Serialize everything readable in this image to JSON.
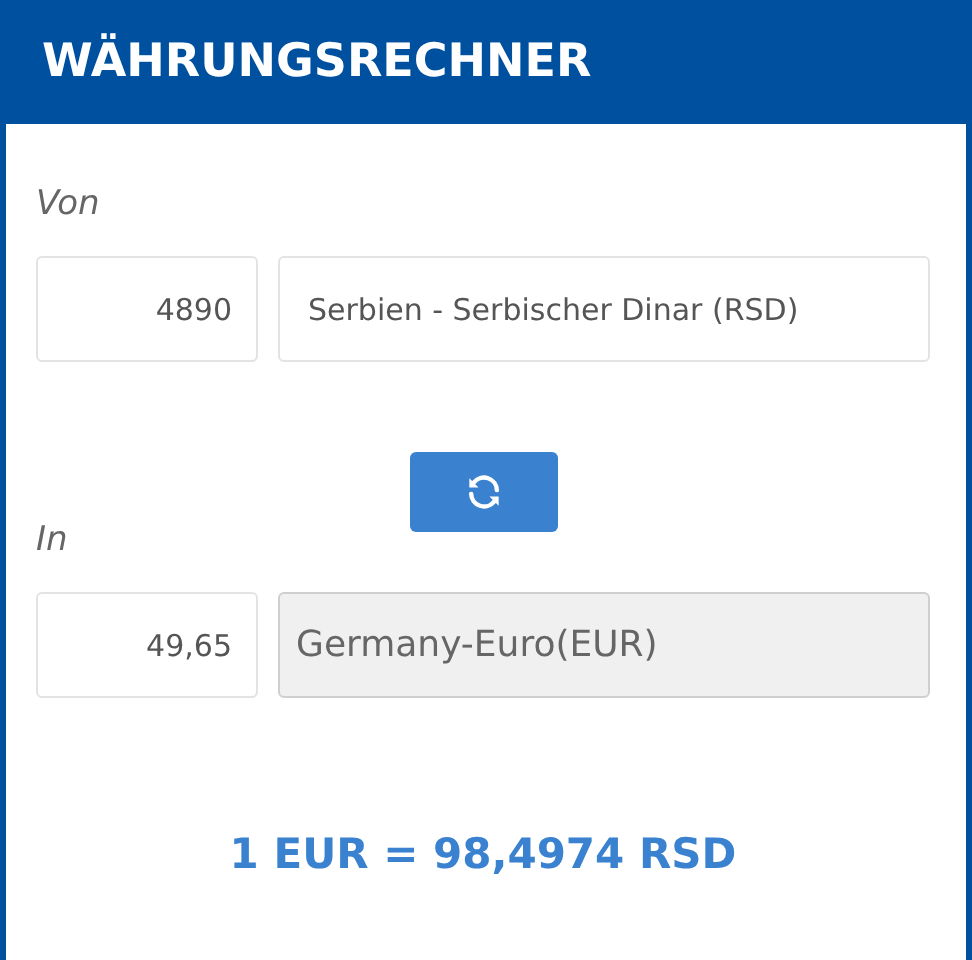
{
  "header": {
    "title": "WÄHRUNGSRECHNER"
  },
  "from": {
    "label": "Von",
    "amount": "4890",
    "currency": "Serbien - Serbischer Dinar (RSD)",
    "disabled": false
  },
  "to": {
    "label": "In",
    "amount": "49,65",
    "currency": "Germany-Euro(EUR)",
    "disabled": true
  },
  "rate": "1 EUR = 98,4974 RSD"
}
